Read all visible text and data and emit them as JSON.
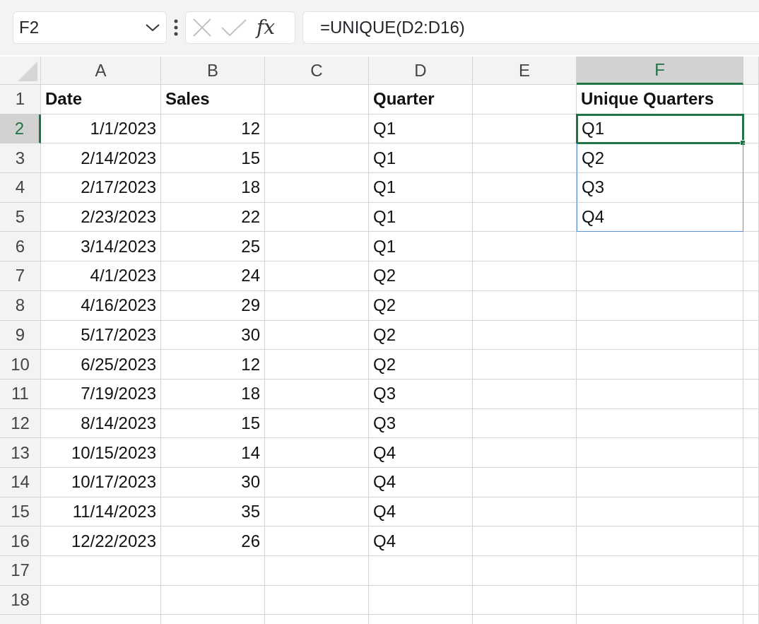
{
  "name_box": {
    "value": "F2"
  },
  "function_button": {
    "label": "fx"
  },
  "formula_bar": {
    "value": "=UNIQUE(D2:D16)"
  },
  "columns": [
    {
      "label": "A",
      "selected": false
    },
    {
      "label": "B",
      "selected": false
    },
    {
      "label": "C",
      "selected": false
    },
    {
      "label": "D",
      "selected": false
    },
    {
      "label": "E",
      "selected": false
    },
    {
      "label": "F",
      "selected": true
    }
  ],
  "rows": [
    {
      "number": "1",
      "selected": false,
      "cells": [
        {
          "text": "Date",
          "kind": "heading",
          "selected": false
        },
        {
          "text": "Sales",
          "kind": "heading",
          "selected": false
        },
        null,
        {
          "text": "Quarter",
          "kind": "heading",
          "selected": false
        },
        null,
        {
          "text": "Unique Quarters",
          "kind": "heading",
          "selected": false
        }
      ]
    },
    {
      "number": "2",
      "selected": true,
      "cells": [
        {
          "text": "1/1/2023",
          "kind": "number",
          "selected": false
        },
        {
          "text": "12",
          "kind": "number",
          "selected": false
        },
        null,
        {
          "text": "Q1",
          "kind": "text",
          "selected": false
        },
        null,
        {
          "text": "Q1",
          "kind": "spill",
          "selected": true
        }
      ]
    },
    {
      "number": "3",
      "selected": false,
      "cells": [
        {
          "text": "2/14/2023",
          "kind": "number",
          "selected": false
        },
        {
          "text": "15",
          "kind": "number",
          "selected": false
        },
        null,
        {
          "text": "Q1",
          "kind": "text",
          "selected": false
        },
        null,
        {
          "text": "Q2",
          "kind": "spill",
          "selected": false
        }
      ]
    },
    {
      "number": "4",
      "selected": false,
      "cells": [
        {
          "text": "2/17/2023",
          "kind": "number",
          "selected": false
        },
        {
          "text": "18",
          "kind": "number",
          "selected": false
        },
        null,
        {
          "text": "Q1",
          "kind": "text",
          "selected": false
        },
        null,
        {
          "text": "Q3",
          "kind": "spill",
          "selected": false
        }
      ]
    },
    {
      "number": "5",
      "selected": false,
      "cells": [
        {
          "text": "2/23/2023",
          "kind": "number",
          "selected": false
        },
        {
          "text": "22",
          "kind": "number",
          "selected": false
        },
        null,
        {
          "text": "Q1",
          "kind": "text",
          "selected": false
        },
        null,
        {
          "text": "Q4",
          "kind": "spill",
          "selected": false
        }
      ]
    },
    {
      "number": "6",
      "selected": false,
      "cells": [
        {
          "text": "3/14/2023",
          "kind": "number",
          "selected": false
        },
        {
          "text": "25",
          "kind": "number",
          "selected": false
        },
        null,
        {
          "text": "Q1",
          "kind": "text",
          "selected": false
        },
        null,
        null
      ]
    },
    {
      "number": "7",
      "selected": false,
      "cells": [
        {
          "text": "4/1/2023",
          "kind": "number",
          "selected": false
        },
        {
          "text": "24",
          "kind": "number",
          "selected": false
        },
        null,
        {
          "text": "Q2",
          "kind": "text",
          "selected": false
        },
        null,
        null
      ]
    },
    {
      "number": "8",
      "selected": false,
      "cells": [
        {
          "text": "4/16/2023",
          "kind": "number",
          "selected": false
        },
        {
          "text": "29",
          "kind": "number",
          "selected": false
        },
        null,
        {
          "text": "Q2",
          "kind": "text",
          "selected": false
        },
        null,
        null
      ]
    },
    {
      "number": "9",
      "selected": false,
      "cells": [
        {
          "text": "5/17/2023",
          "kind": "number",
          "selected": false
        },
        {
          "text": "30",
          "kind": "number",
          "selected": false
        },
        null,
        {
          "text": "Q2",
          "kind": "text",
          "selected": false
        },
        null,
        null
      ]
    },
    {
      "number": "10",
      "selected": false,
      "cells": [
        {
          "text": "6/25/2023",
          "kind": "number",
          "selected": false
        },
        {
          "text": "12",
          "kind": "number",
          "selected": false
        },
        null,
        {
          "text": "Q2",
          "kind": "text",
          "selected": false
        },
        null,
        null
      ]
    },
    {
      "number": "11",
      "selected": false,
      "cells": [
        {
          "text": "7/19/2023",
          "kind": "number",
          "selected": false
        },
        {
          "text": "18",
          "kind": "number",
          "selected": false
        },
        null,
        {
          "text": "Q3",
          "kind": "text",
          "selected": false
        },
        null,
        null
      ]
    },
    {
      "number": "12",
      "selected": false,
      "cells": [
        {
          "text": "8/14/2023",
          "kind": "number",
          "selected": false
        },
        {
          "text": "15",
          "kind": "number",
          "selected": false
        },
        null,
        {
          "text": "Q3",
          "kind": "text",
          "selected": false
        },
        null,
        null
      ]
    },
    {
      "number": "13",
      "selected": false,
      "cells": [
        {
          "text": "10/15/2023",
          "kind": "number",
          "selected": false
        },
        {
          "text": "14",
          "kind": "number",
          "selected": false
        },
        null,
        {
          "text": "Q4",
          "kind": "text",
          "selected": false
        },
        null,
        null
      ]
    },
    {
      "number": "14",
      "selected": false,
      "cells": [
        {
          "text": "10/17/2023",
          "kind": "number",
          "selected": false
        },
        {
          "text": "30",
          "kind": "number",
          "selected": false
        },
        null,
        {
          "text": "Q4",
          "kind": "text",
          "selected": false
        },
        null,
        null
      ]
    },
    {
      "number": "15",
      "selected": false,
      "cells": [
        {
          "text": "11/14/2023",
          "kind": "number",
          "selected": false
        },
        {
          "text": "35",
          "kind": "number",
          "selected": false
        },
        null,
        {
          "text": "Q4",
          "kind": "text",
          "selected": false
        },
        null,
        null
      ]
    },
    {
      "number": "16",
      "selected": false,
      "cells": [
        {
          "text": "12/22/2023",
          "kind": "number",
          "selected": false
        },
        {
          "text": "26",
          "kind": "number",
          "selected": false
        },
        null,
        {
          "text": "Q4",
          "kind": "text",
          "selected": false
        },
        null,
        null
      ]
    },
    {
      "number": "17",
      "selected": false,
      "cells": [
        null,
        null,
        null,
        null,
        null,
        null
      ]
    },
    {
      "number": "18",
      "selected": false,
      "cells": [
        null,
        null,
        null,
        null,
        null,
        null
      ]
    }
  ]
}
